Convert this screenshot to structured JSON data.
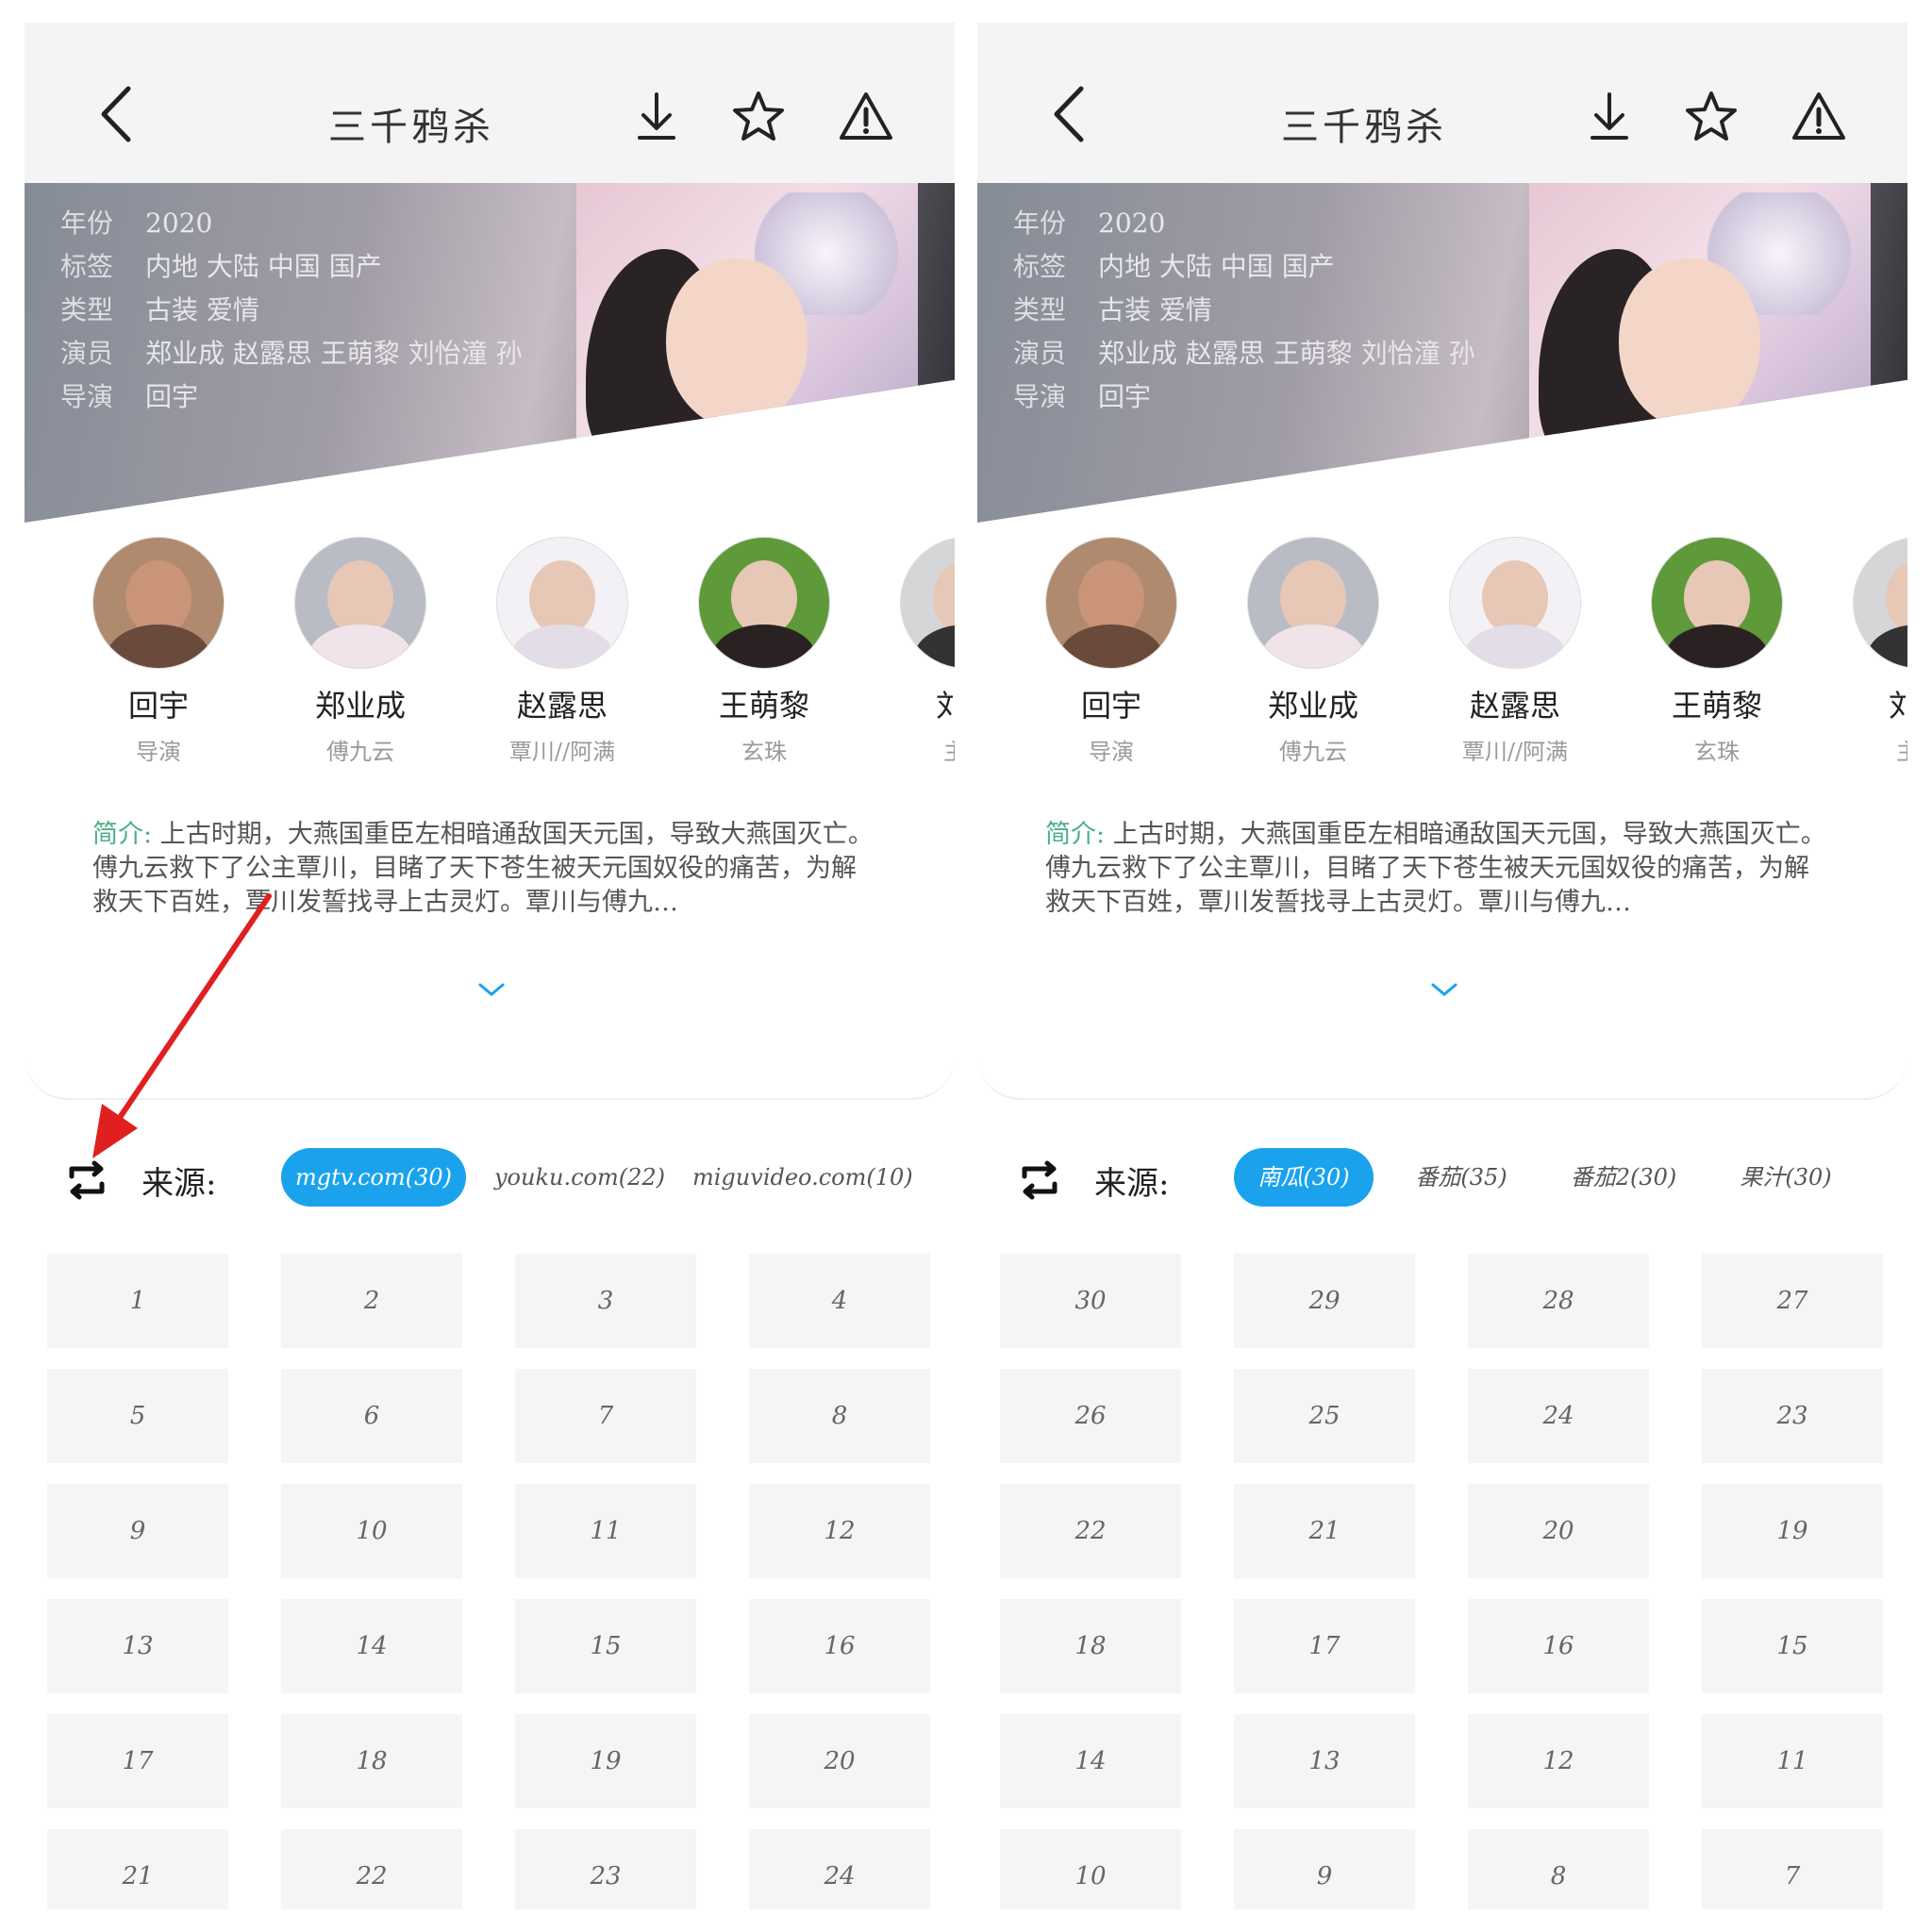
{
  "screens": [
    {
      "title": "三千鸦杀",
      "meta": [
        {
          "k": "年份",
          "v": "2020"
        },
        {
          "k": "标签",
          "v": "内地 大陆 中国 国产"
        },
        {
          "k": "类型",
          "v": "古装 爱情"
        },
        {
          "k": "演员",
          "v": "郑业成 赵露思 王萌黎 刘怡潼 孙"
        },
        {
          "k": "导演",
          "v": "回宇"
        }
      ],
      "cast": [
        {
          "name": "回宇",
          "role": "导演"
        },
        {
          "name": "郑业成",
          "role": "傅九云"
        },
        {
          "name": "赵露思",
          "role": "覃川//阿满"
        },
        {
          "name": "王萌黎",
          "role": "玄珠"
        },
        {
          "name": "刘怡",
          "role": "主演"
        }
      ],
      "intro_label": "简介:",
      "intro_text": "上古时期，大燕国重臣左相暗通敌国天元国，导致大燕国灭亡。傅九云救下了公主覃川，目睹了天下苍生被天元国奴役的痛苦，为解救天下百姓，覃川发誓找寻上古灵灯。覃川与傅九…",
      "source_label": "来源:",
      "sources": [
        "mgtv.com(30)",
        "youku.com(22)",
        "miguvideo.com(10)"
      ],
      "active_source": 0,
      "episodes": [
        "1",
        "2",
        "3",
        "4",
        "5",
        "6",
        "7",
        "8",
        "9",
        "10",
        "11",
        "12",
        "13",
        "14",
        "15",
        "16",
        "17",
        "18",
        "19",
        "20",
        "21",
        "22",
        "23",
        "24"
      ]
    },
    {
      "title": "三千鸦杀",
      "meta": [
        {
          "k": "年份",
          "v": "2020"
        },
        {
          "k": "标签",
          "v": "内地 大陆 中国 国产"
        },
        {
          "k": "类型",
          "v": "古装 爱情"
        },
        {
          "k": "演员",
          "v": "郑业成 赵露思 王萌黎 刘怡潼 孙"
        },
        {
          "k": "导演",
          "v": "回宇"
        }
      ],
      "cast": [
        {
          "name": "回宇",
          "role": "导演"
        },
        {
          "name": "郑业成",
          "role": "傅九云"
        },
        {
          "name": "赵露思",
          "role": "覃川//阿满"
        },
        {
          "name": "王萌黎",
          "role": "玄珠"
        },
        {
          "name": "刘怡",
          "role": "主演"
        }
      ],
      "intro_label": "简介:",
      "intro_text": "上古时期，大燕国重臣左相暗通敌国天元国，导致大燕国灭亡。傅九云救下了公主覃川，目睹了天下苍生被天元国奴役的痛苦，为解救天下百姓，覃川发誓找寻上古灵灯。覃川与傅九…",
      "source_label": "来源:",
      "sources": [
        "南瓜(30)",
        "番茄(35)",
        "番茄2(30)",
        "果汁(30)"
      ],
      "active_source": 0,
      "episodes": [
        "30",
        "29",
        "28",
        "27",
        "26",
        "25",
        "24",
        "23",
        "22",
        "21",
        "20",
        "19",
        "18",
        "17",
        "16",
        "15",
        "14",
        "13",
        "12",
        "11",
        "10",
        "9",
        "8",
        "7"
      ]
    }
  ],
  "colors": {
    "accent": "#1aa3ec",
    "intro_label": "#4cb087",
    "episode_bg": "#f5f5f5",
    "annotation_arrow": "#e02020"
  },
  "icons": [
    "back-icon",
    "download-icon",
    "star-icon",
    "warning-icon",
    "swap-source-icon",
    "chevron-down-icon"
  ]
}
